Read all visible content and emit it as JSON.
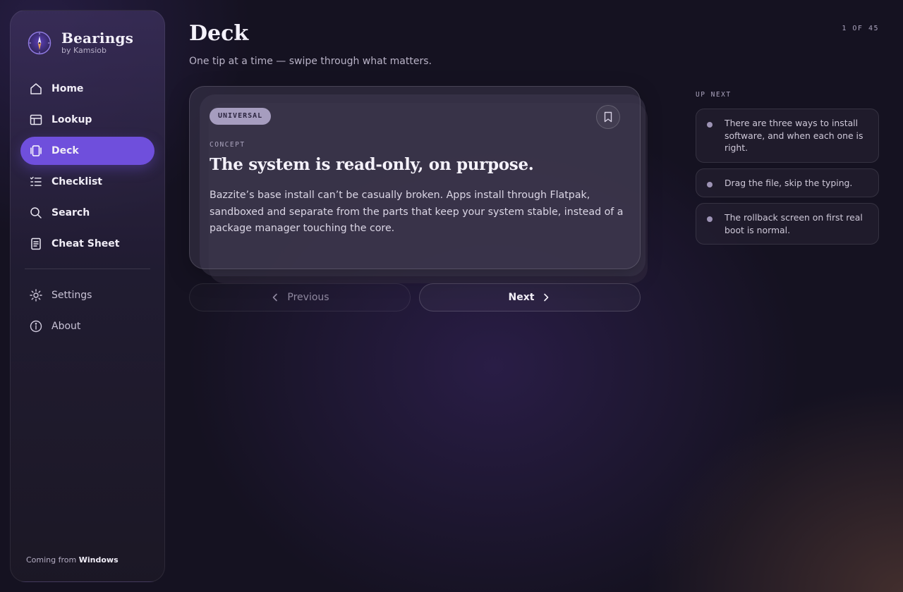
{
  "app": {
    "name": "Bearings",
    "byline": "by Kamsiob"
  },
  "sidebar": {
    "items": [
      {
        "label": "Home",
        "icon": "home-icon"
      },
      {
        "label": "Lookup",
        "icon": "table-icon"
      },
      {
        "label": "Deck",
        "icon": "cards-icon",
        "active": true
      },
      {
        "label": "Checklist",
        "icon": "checklist-icon"
      },
      {
        "label": "Search",
        "icon": "search-icon"
      },
      {
        "label": "Cheat Sheet",
        "icon": "document-icon"
      }
    ],
    "secondary": [
      {
        "label": "Settings",
        "icon": "gear-icon"
      },
      {
        "label": "About",
        "icon": "info-icon"
      }
    ],
    "footer": {
      "prefix": "Coming from",
      "platform": "Windows"
    }
  },
  "header": {
    "title": "Deck",
    "subtitle": "One tip at a time — swipe through what matters.",
    "counter": "1 OF 45"
  },
  "card": {
    "tag": "UNIVERSAL",
    "kind": "CONCEPT",
    "title": "The system is read-only, on purpose.",
    "body": "Bazzite’s base install can’t be casually broken. Apps install through Flatpak, sandboxed and separate from the parts that keep your system stable, instead of a package manager touching the core."
  },
  "controls": {
    "previous": "Previous",
    "next": "Next"
  },
  "up_next": {
    "title": "UP NEXT",
    "items": [
      "There are three ways to install software, and when each one is right.",
      "Drag the file, skip the typing.",
      "The rollback screen on first real boot is normal."
    ]
  },
  "colors": {
    "accent": "#6f4fdc",
    "background": "#151221",
    "tag": "#a69dbf"
  }
}
